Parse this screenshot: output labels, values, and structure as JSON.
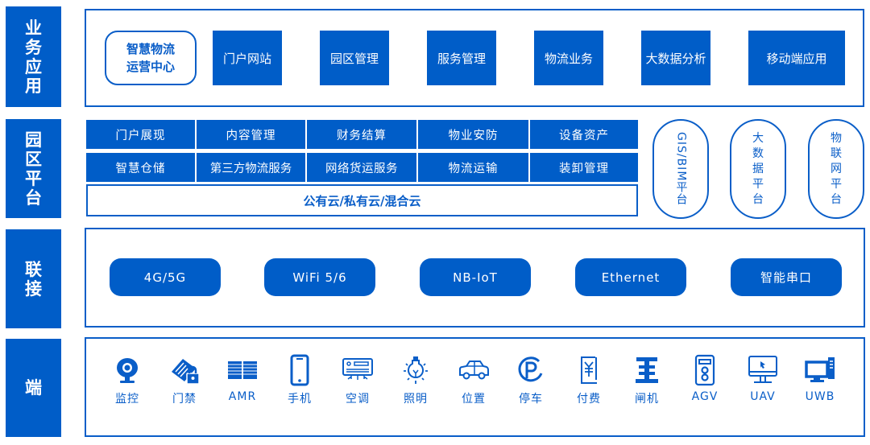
{
  "layers": {
    "business": {
      "label_chars": [
        "业",
        "务",
        "应",
        "用"
      ]
    },
    "platform": {
      "label_chars": [
        "园",
        "区",
        "平",
        "台"
      ]
    },
    "connect": {
      "label_chars": [
        "联",
        "接"
      ]
    },
    "terminal": {
      "label_chars": [
        "端"
      ]
    }
  },
  "business_apps": {
    "center": {
      "line1": "智慧物流",
      "line2": "运营中心"
    },
    "items": [
      "门户网站",
      "园区管理",
      "服务管理",
      "物流业务",
      "大数据分析",
      "移动端应用"
    ]
  },
  "platform": {
    "row1": [
      "门户展现",
      "内容管理",
      "财务结算",
      "物业安防",
      "设备资产"
    ],
    "row2": [
      "智慧仓储",
      "第三方物流服务",
      "网络货运服务",
      "物流运输",
      "装卸管理"
    ],
    "cloud": "公有云/私有云/混合云",
    "side_platforms": [
      {
        "name": "GIS/BIM平台"
      },
      {
        "chars": [
          "大",
          "数",
          "据",
          "平",
          "台"
        ]
      },
      {
        "chars": [
          "物",
          "联",
          "网",
          "平",
          "台"
        ]
      }
    ]
  },
  "connectivity": [
    "4G/5G",
    "WiFi 5/6",
    "NB-IoT",
    "Ethernet",
    "智能串口"
  ],
  "devices": [
    {
      "label": "监控",
      "icon": "camera-icon"
    },
    {
      "label": "门禁",
      "icon": "access-card-lock-icon"
    },
    {
      "label": "AMR",
      "icon": "shelf-robot-icon"
    },
    {
      "label": "手机",
      "icon": "phone-icon"
    },
    {
      "label": "空调",
      "icon": "air-conditioner-icon"
    },
    {
      "label": "照明",
      "icon": "light-bulb-icon"
    },
    {
      "label": "位置",
      "icon": "car-icon"
    },
    {
      "label": "停车",
      "icon": "parking-icon"
    },
    {
      "label": "付费",
      "icon": "payment-icon"
    },
    {
      "label": "闸机",
      "icon": "gate-icon"
    },
    {
      "label": "AGV",
      "icon": "agv-icon"
    },
    {
      "label": "UAV",
      "icon": "monitor-cursor-icon"
    },
    {
      "label": "UWB",
      "icon": "desktop-computer-icon"
    }
  ],
  "colors": {
    "primary": "#005dc8",
    "outline": "#0a5ec8",
    "background": "#ffffff"
  }
}
